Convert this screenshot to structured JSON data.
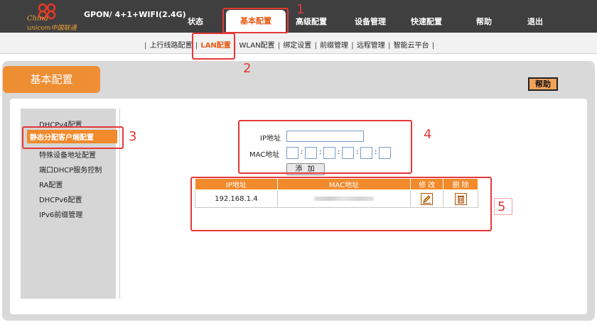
{
  "header": {
    "logo_line1": "China",
    "logo_line2": "unicom中国联通",
    "model": "GPON/ 4+1+WIFI(2.4G)",
    "tabs": [
      "状态",
      "基本配置",
      "高级配置",
      "设备管理",
      "快速配置",
      "帮助",
      "退出"
    ],
    "active_tab": "基本配置"
  },
  "subnav": {
    "items": [
      "上行线路配置",
      "LAN配置",
      "WLAN配置",
      "绑定设置",
      "前缀管理",
      "远程管理",
      "智能云平台"
    ],
    "active": "LAN配置"
  },
  "page": {
    "title": "基本配置",
    "help_label": "帮助"
  },
  "left_menu": {
    "items": [
      "DHCPv4配置",
      "静态分配客户端配置",
      "特殊设备地址配置",
      "端口DHCP服务控制",
      "RA配置",
      "DHCPv6配置",
      "IPv6前缀管理"
    ],
    "active": "静态分配客户端配置"
  },
  "form": {
    "ip_label": "IP地址",
    "mac_label": "MAC地址",
    "ip_value": "",
    "add_label": "添 加"
  },
  "table": {
    "headers": [
      "IP地址",
      "MAC地址",
      "修 改",
      "删 除"
    ],
    "rows": [
      {
        "ip": "192.168.1.4",
        "mac": ""
      }
    ]
  },
  "annotations": [
    "1",
    "2",
    "3",
    "4",
    "5"
  ],
  "colors": {
    "header_bg": "#3f3f3f",
    "accent_orange": "#f08a2b",
    "active_text": "#e85b15",
    "annotation_red": "#e53838"
  }
}
